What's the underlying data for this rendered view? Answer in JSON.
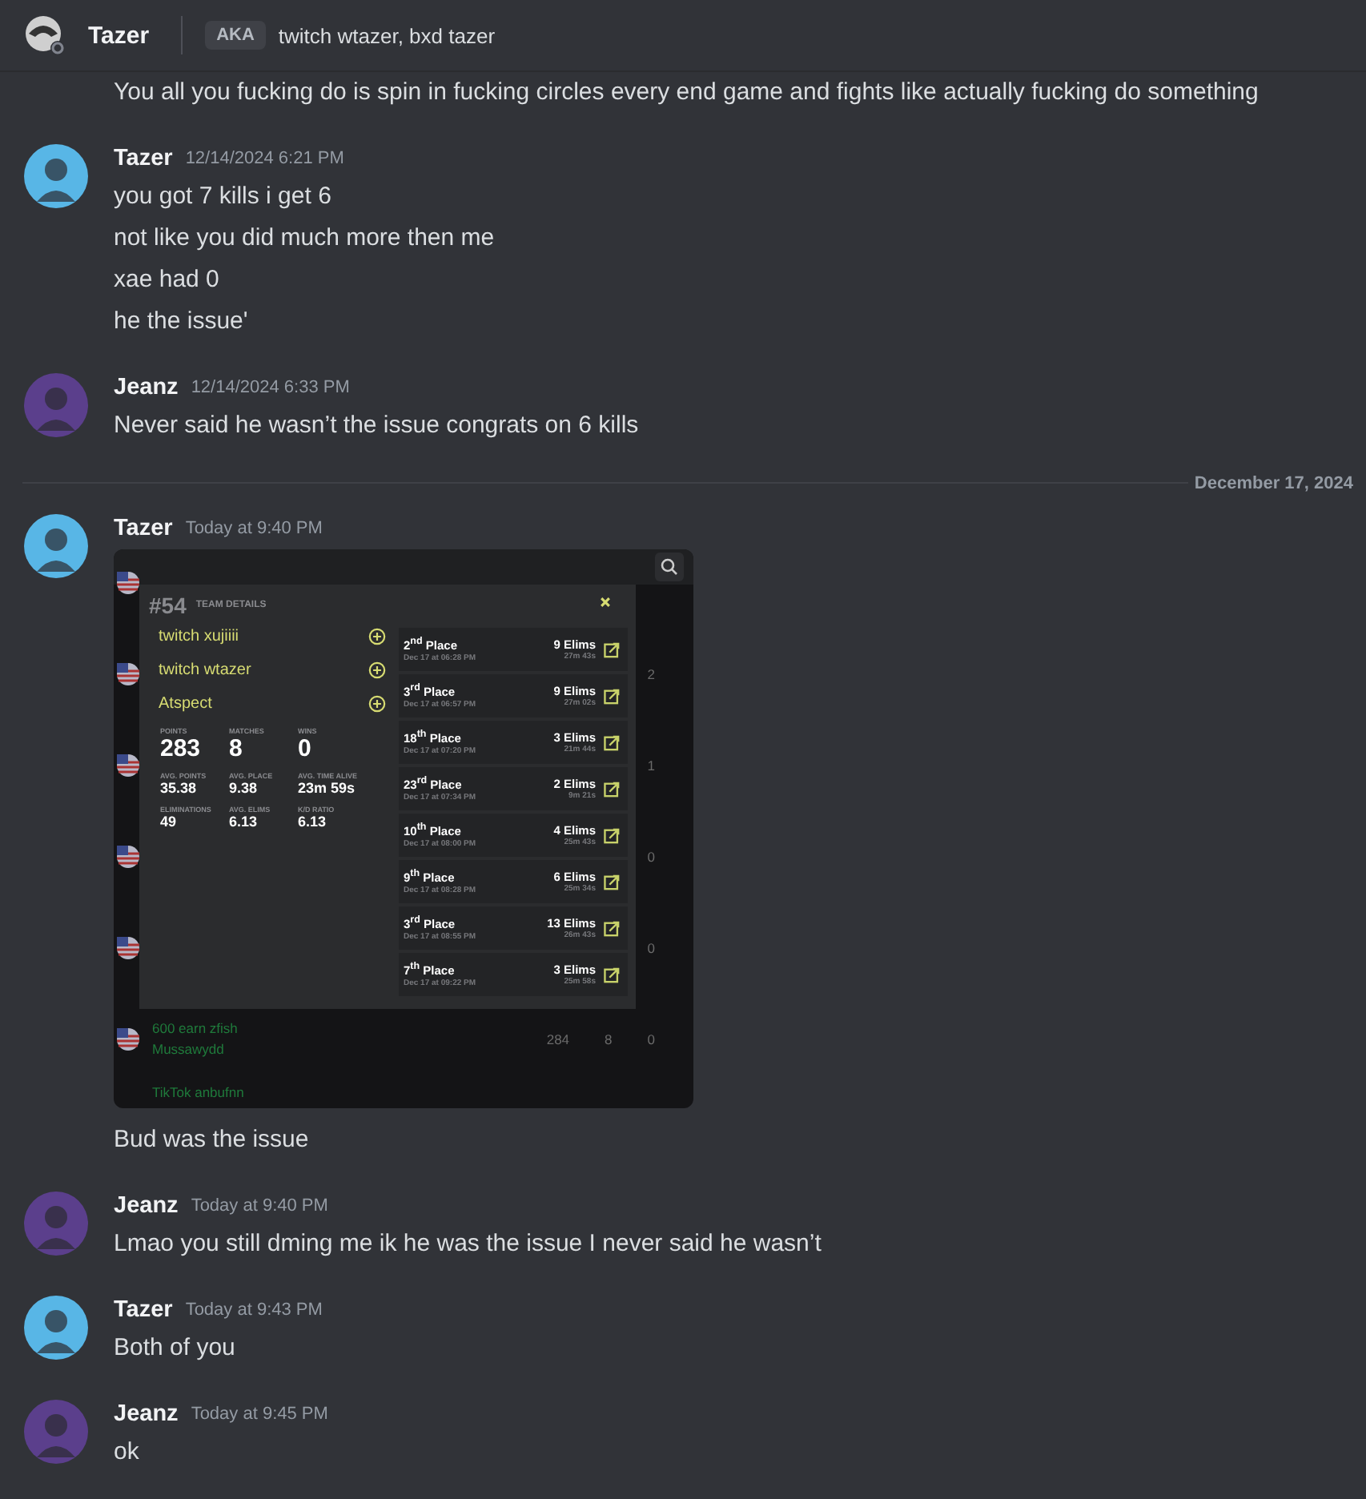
{
  "header": {
    "name": "Tazer",
    "aka_label": "AKA",
    "aka": "twitch wtazer, bxd tazer"
  },
  "messages": [
    {
      "kind": "continuation",
      "lines": [
        "You all you fucking do is spin in fucking circles every end game and fights like actually fucking do something"
      ]
    },
    {
      "kind": "group",
      "author": "Tazer",
      "color": "#58b6e6",
      "time": "12/14/2024 6:21 PM",
      "lines": [
        "you got 7 kills i get 6",
        "not like you did much more then me",
        "xae had 0",
        "he the issue'"
      ]
    },
    {
      "kind": "group",
      "author": "Jeanz",
      "color": "#5b3f8c",
      "time": "12/14/2024 6:33 PM",
      "lines": [
        "Never said he wasn’t the issue congrats on 6 kills"
      ]
    },
    {
      "kind": "divider",
      "label": "December 17, 2024"
    },
    {
      "kind": "group",
      "author": "Tazer",
      "color": "#58b6e6",
      "time": "Today at 9:40 PM",
      "lines": [
        "Bud was the issue"
      ],
      "embed": {
        "rank": "#54",
        "title": "TEAM DETAILS",
        "players": [
          "twitch xujiiii",
          "twitch wtazer",
          "Atspect"
        ],
        "stats": [
          {
            "label": "POINTS",
            "value": "283",
            "kind": "big"
          },
          {
            "label": "MATCHES",
            "value": "8",
            "kind": "big"
          },
          {
            "label": "WINS",
            "value": "0",
            "kind": "big"
          },
          {
            "label": "AVG. POINTS",
            "value": "35.38",
            "kind": "small"
          },
          {
            "label": "AVG. PLACE",
            "value": "9.38",
            "kind": "small"
          },
          {
            "label": "AVG. TIME ALIVE",
            "value": "23m 59s",
            "kind": "small"
          },
          {
            "label": "ELIMINATIONS",
            "value": "49",
            "kind": "small"
          },
          {
            "label": "AVG. ELIMS",
            "value": "6.13",
            "kind": "small"
          },
          {
            "label": "K/D RATIO",
            "value": "6.13",
            "kind": "small"
          }
        ],
        "matches": [
          {
            "place": "2$^{nd}$ Place",
            "date": "Dec 17 at 06:28 PM",
            "elims": "9 Elims",
            "duration": "27m 43s"
          },
          {
            "place": "3$^{rd}$ Place",
            "date": "Dec 17 at 06:57 PM",
            "elims": "9 Elims",
            "duration": "27m 02s"
          },
          {
            "place": "18$^{th}$ Place",
            "date": "Dec 17 at 07:20 PM",
            "elims": "3 Elims",
            "duration": "21m 44s"
          },
          {
            "place": "23$^{rd}$ Place",
            "date": "Dec 17 at 07:34 PM",
            "elims": "2 Elims",
            "duration": "9m 21s"
          },
          {
            "place": "10$^{th}$ Place",
            "date": "Dec 17 at 08:00 PM",
            "elims": "4 Elims",
            "duration": "25m 43s"
          },
          {
            "place": "9$^{th}$ Place",
            "date": "Dec 17 at 08:28 PM",
            "elims": "6 Elims",
            "duration": "25m 34s"
          },
          {
            "place": "3$^{rd}$ Place",
            "date": "Dec 17 at 08:55 PM",
            "elims": "13 Elims",
            "duration": "26m 43s"
          },
          {
            "place": "7$^{th}$ Place",
            "date": "Dec 17 at 09:22 PM",
            "elims": "3 Elims",
            "duration": "25m 58s"
          }
        ],
        "background_rows": [
          {
            "flag": true,
            "names": [],
            "cells": []
          },
          {
            "flag": true,
            "names": [],
            "cells": [
              "2"
            ]
          },
          {
            "flag": true,
            "names": [],
            "cells": [
              "1"
            ]
          },
          {
            "flag": true,
            "names": [],
            "cells": [
              "0"
            ]
          },
          {
            "flag": true,
            "names": [],
            "cells": [
              "0"
            ]
          },
          {
            "flag": true,
            "names": [
              "600 earn zfish",
              "Mussawydd"
            ],
            "cells": [
              "284",
              "8",
              "0"
            ]
          },
          {
            "flag": false,
            "names": [
              "TikTok anbufnn"
            ],
            "cells": []
          }
        ]
      }
    },
    {
      "kind": "group",
      "author": "Jeanz",
      "color": "#5b3f8c",
      "time": "Today at 9:40 PM",
      "lines": [
        "Lmao you still dming me ik he was the issue I never said he wasn’t"
      ]
    },
    {
      "kind": "group",
      "author": "Tazer",
      "color": "#58b6e6",
      "time": "Today at 9:43 PM",
      "lines": [
        "Both of you"
      ]
    },
    {
      "kind": "group",
      "author": "Jeanz",
      "color": "#5b3f8c",
      "time": "Today at 9:45 PM",
      "lines": [
        "ok"
      ]
    }
  ]
}
